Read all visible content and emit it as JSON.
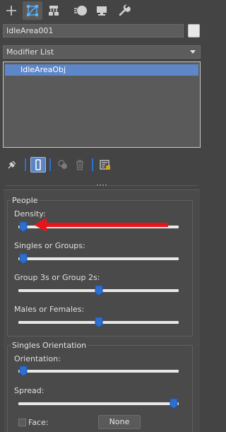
{
  "tabs": [
    {
      "id": "create",
      "icon": "plus-icon"
    },
    {
      "id": "modify",
      "icon": "modify-icon",
      "active": true
    },
    {
      "id": "hierarchy",
      "icon": "hierarchy-icon"
    },
    {
      "id": "motion",
      "icon": "motion-icon"
    },
    {
      "id": "display",
      "icon": "display-icon"
    },
    {
      "id": "utilities",
      "icon": "wrench-icon"
    }
  ],
  "object": {
    "name": "IdleArea001",
    "color": "#e8e8e8"
  },
  "modifier_list": {
    "label": "Modifier List"
  },
  "stack": {
    "items": [
      {
        "label": "IdleAreaObj",
        "selected": true
      }
    ]
  },
  "stack_tools": [
    {
      "icon": "pin-stack-icon"
    },
    {
      "icon": "show-end-result-icon",
      "active": true
    },
    {
      "icon": "make-unique-icon"
    },
    {
      "icon": "remove-modifier-icon"
    },
    {
      "icon": "configure-modifier-sets-icon"
    }
  ],
  "people": {
    "title": "People",
    "density": {
      "label": "Density:",
      "value": 0.03
    },
    "singles_groups": {
      "label": "Singles or Groups:",
      "value": 0.03
    },
    "group3s_2s": {
      "label": "Group 3s or Group 2s:",
      "value": 0.5
    },
    "males_females": {
      "label": "Males or Females:",
      "value": 0.5
    }
  },
  "singles_orientation": {
    "title": "Singles Orientation",
    "orientation": {
      "label": "Orientation:",
      "value": 0.03
    },
    "spread": {
      "label": "Spread:",
      "value": 0.97
    },
    "face": {
      "label": "Face:",
      "checked": false,
      "button_label": "None"
    }
  },
  "colors": {
    "accent": "#2c6fd0",
    "selection": "#5d87c8",
    "annotation_arrow": "#e8141c"
  }
}
